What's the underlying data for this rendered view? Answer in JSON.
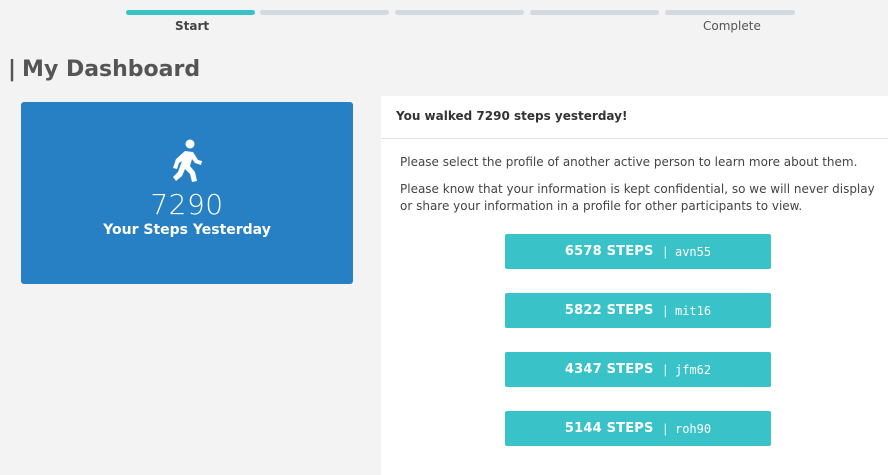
{
  "progress": {
    "start_label": "Start",
    "complete_label": "Complete",
    "accent_color": "#39c3c8",
    "inactive_color": "#d3dadf",
    "current_step": 1,
    "total_steps": 5
  },
  "page_title": "My Dashboard",
  "steps_card": {
    "icon": "walking-person-icon",
    "count": "7290",
    "caption": "Your Steps Yesterday",
    "color": "#2780c4"
  },
  "panel": {
    "header": "You walked 7290 steps yesterday!",
    "instruction": "Please select the profile of another active person to learn more about them.",
    "confidential_note": "Please know that your information is kept confidential, so we will never display or share your information in a profile for other participants to view."
  },
  "profiles": [
    {
      "steps": "6578 STEPS",
      "separator": "|",
      "username": "avn55"
    },
    {
      "steps": "5822 STEPS",
      "separator": "|",
      "username": "mit16"
    },
    {
      "steps": "4347 STEPS",
      "separator": "|",
      "username": "jfm62"
    },
    {
      "steps": "5144 STEPS",
      "separator": "|",
      "username": "roh90"
    }
  ]
}
